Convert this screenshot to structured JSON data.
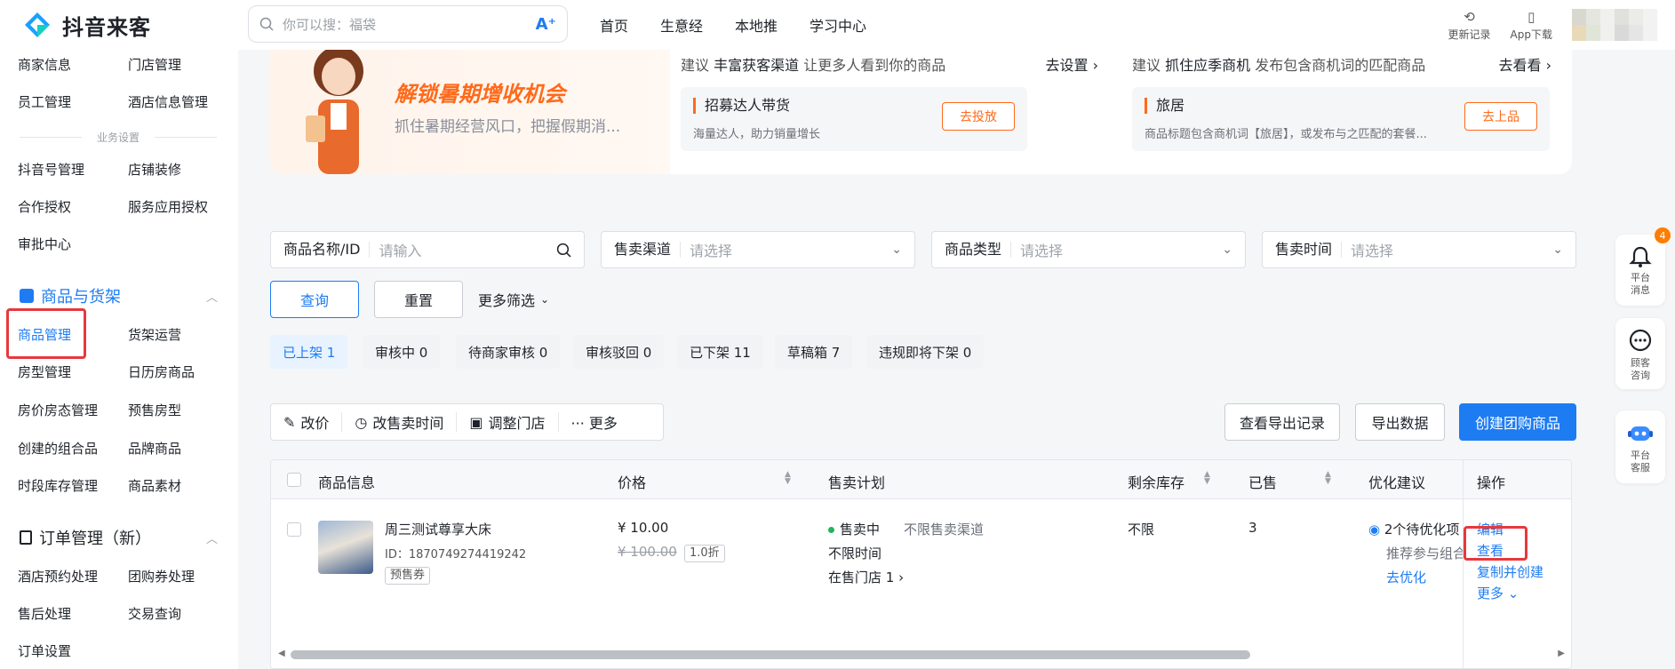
{
  "app": {
    "name": "抖音来客"
  },
  "search": {
    "placeholder": "你可以搜：福袋",
    "ai_label": "A⁺"
  },
  "nav": [
    "首页",
    "生意经",
    "本地推",
    "学习中心"
  ],
  "top_right": {
    "changelog": "更新记录",
    "app_download": "App下载"
  },
  "sidebar": {
    "rows": [
      [
        "商家信息",
        "门店管理"
      ],
      [
        "员工管理",
        "酒店信息管理"
      ],
      [
        "抖音号管理",
        "店铺装修"
      ],
      [
        "合作授权",
        "服务应用授权"
      ],
      [
        "审批中心",
        ""
      ]
    ],
    "divider": "业务设置",
    "group_goods": "商品与货架",
    "goods_rows": [
      [
        "商品管理",
        "货架运营"
      ],
      [
        "房型管理",
        "日历房商品"
      ],
      [
        "房价房态管理",
        "预售房型"
      ],
      [
        "创建的组合品",
        "品牌商品"
      ],
      [
        "时段库存管理",
        "商品素材"
      ]
    ],
    "group_orders": "订单管理（新）",
    "order_rows": [
      [
        "酒店预约处理",
        "团购券处理"
      ],
      [
        "售后处理",
        "交易查询"
      ],
      [
        "订单设置",
        ""
      ]
    ]
  },
  "promo": {
    "title": "解锁暑期增收机会",
    "subtitle": "抓住暑期经营风口，把握假期消..."
  },
  "suggestions": [
    {
      "prefix": "建议",
      "highlight": "丰富获客渠道",
      "rest": "让更多人看到你的商品",
      "go": "去设置 ›",
      "item_title": "招募达人带货",
      "item_desc": "海量达人，助力销量增长",
      "button": "去投放"
    },
    {
      "prefix": "建议",
      "highlight": "抓住应季商机",
      "rest": "发布包含商机词的匹配商品",
      "go": "去看看 ›",
      "item_title": "旅居",
      "item_desc": "商品标题包含商机词【旅居】，或发布与之匹配的套餐...",
      "button": "去上品"
    }
  ],
  "filters": [
    {
      "label": "商品名称/ID",
      "placeholder": "请输入",
      "icon": "search-icon"
    },
    {
      "label": "售卖渠道",
      "placeholder": "请选择",
      "icon": "chevron-down-icon"
    },
    {
      "label": "商品类型",
      "placeholder": "请选择",
      "icon": "chevron-down-icon"
    },
    {
      "label": "售卖时间",
      "placeholder": "请选择",
      "icon": "chevron-down-icon"
    }
  ],
  "buttons": {
    "query": "查询",
    "reset": "重置",
    "more_filter": "更多筛选"
  },
  "status_tabs": [
    "已上架 1",
    "审核中 0",
    "待商家审核 0",
    "审核驳回 0",
    "已下架 11",
    "草稿箱 7",
    "违规即将下架 0"
  ],
  "batch_actions": [
    "改价",
    "改售卖时间",
    "调整门店",
    "··· 更多"
  ],
  "actions": {
    "export_log": "查看导出记录",
    "export": "导出数据",
    "create": "创建团购商品"
  },
  "table": {
    "headers": {
      "info": "商品信息",
      "price": "价格",
      "plan": "售卖计划",
      "stock": "剩余库存",
      "sold": "已售",
      "advice": "优化建议",
      "ops": "操作"
    },
    "row": {
      "name": "周三测试尊享大床",
      "id": "ID：1870749274419242",
      "tag": "预售券",
      "price": "¥ 10.00",
      "orig_price": "¥ 100.00",
      "discount": "1.0折",
      "status": "售卖中",
      "channel": "不限售卖渠道",
      "time": "不限时间",
      "stores": "在售门店 1 ›",
      "stock": "不限",
      "sold": "3",
      "advice_count": "2个待优化项",
      "advice_desc": "推荐参与组合",
      "advice_link": "去优化",
      "ops": [
        "编辑",
        "查看",
        "复制并创建",
        "更多 ⌄"
      ]
    }
  },
  "float": {
    "badge": "4",
    "notice": "平台消息",
    "consult": "顾客咨询",
    "service": "平台客服"
  },
  "colors": {
    "accent": "#1e7cf2",
    "orange": "#ff6a1a",
    "highlight_box": "#e8383d"
  }
}
